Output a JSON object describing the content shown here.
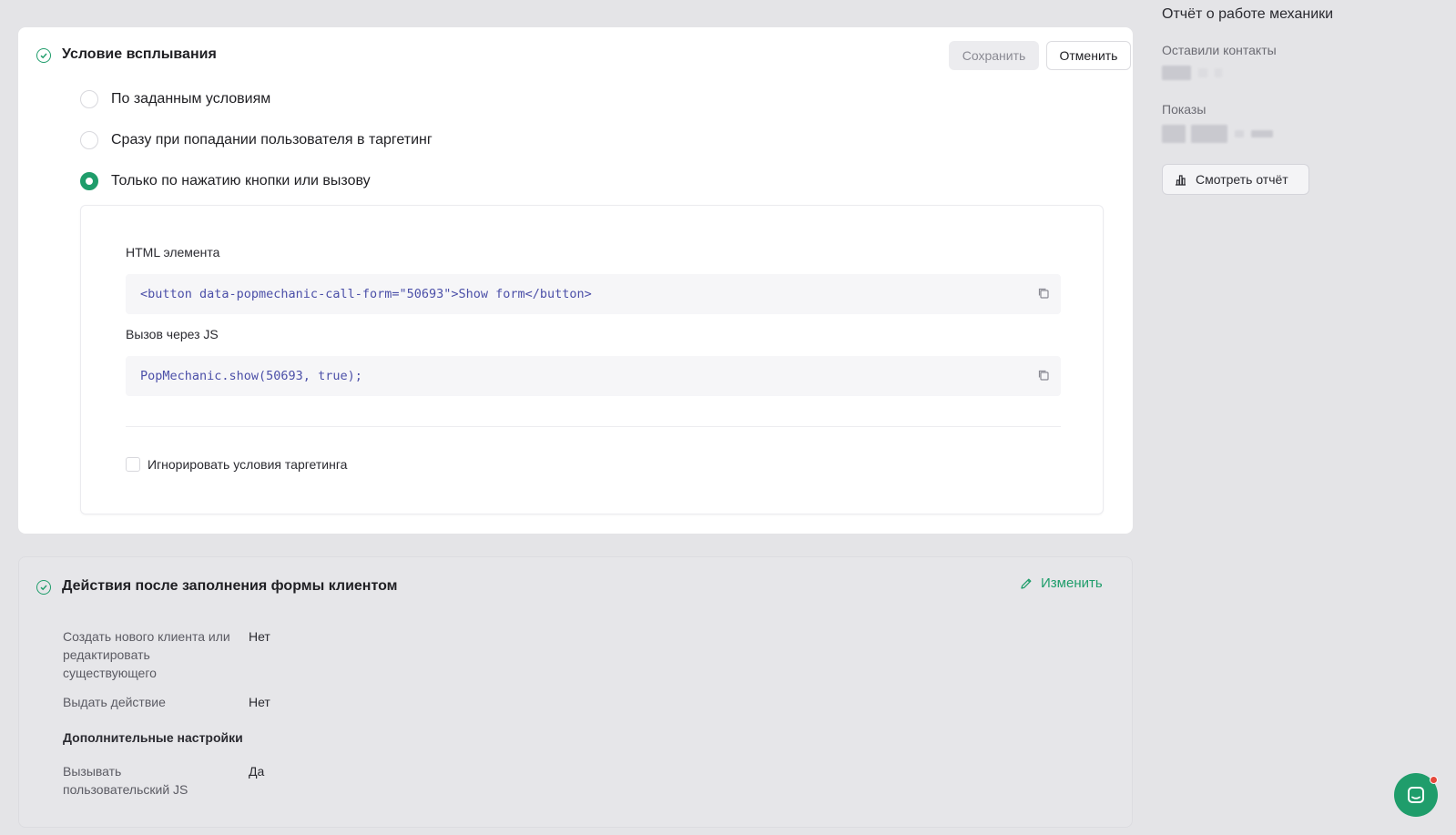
{
  "popup_condition": {
    "title": "Условие всплывания",
    "save_label": "Сохранить",
    "cancel_label": "Отменить",
    "options": [
      {
        "label": "По заданным условиям",
        "selected": false
      },
      {
        "label": "Сразу при попадании пользователя в таргетинг",
        "selected": false
      },
      {
        "label": "Только по нажатию кнопки или вызову",
        "selected": true
      }
    ],
    "html_label": "HTML элемента",
    "html_code": "<button data-popmechanic-call-form=\"50693\">Show form</button>",
    "js_label": "Вызов через JS",
    "js_code": "PopMechanic.show(50693, true);",
    "ignore_targeting_label": "Игнорировать условия таргетинга",
    "ignore_targeting_checked": false
  },
  "after_submit": {
    "title": "Действия после заполнения формы клиентом",
    "edit_label": "Изменить",
    "rows": [
      {
        "key": "Создать нового клиента или редактировать существующего",
        "value": "Нет"
      },
      {
        "key": "Выдать действие",
        "value": "Нет"
      }
    ],
    "extra_title": "Дополнительные настройки",
    "extra_rows": [
      {
        "key": "Вызывать пользовательский JS",
        "value": "Да"
      }
    ]
  },
  "report": {
    "title": "Отчёт о работе механики",
    "contacts_label": "Оставили контакты",
    "views_label": "Показы",
    "view_report_label": "Смотреть отчёт"
  },
  "colors": {
    "accent": "#1f9d6b",
    "notification": "#e5483b"
  }
}
